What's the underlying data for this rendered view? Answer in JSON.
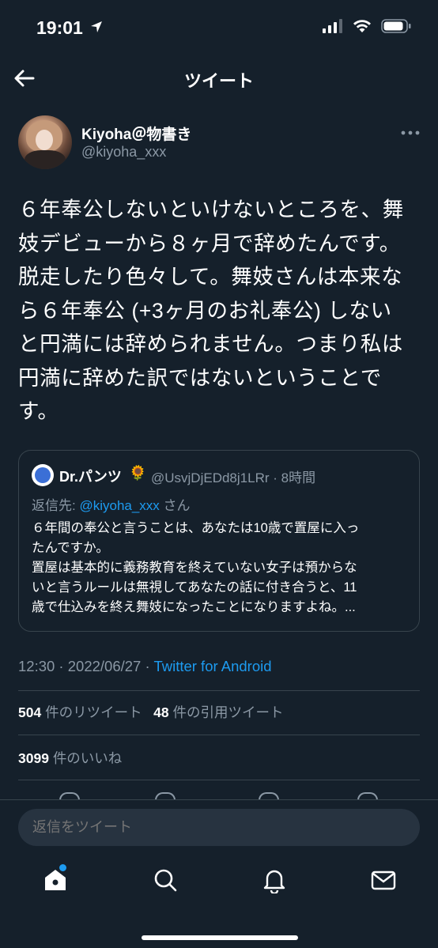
{
  "status_bar": {
    "time": "19:01"
  },
  "nav": {
    "title": "ツイート"
  },
  "author": {
    "name": "Kiyoha＠物書き",
    "handle": "@kiyoha_xxx"
  },
  "tweet": {
    "lines": [
      "６年奉公しないといけないところを、舞",
      "妓デビューから８ヶ月で辞めたんです。",
      "脱走したり色々して。舞妓さんは本来な",
      "ら６年奉公 (+3ヶ月のお礼奉公) しない",
      "と円満には辞められません。つまり私は",
      "円満に辞めた訳ではないということで",
      "す。"
    ]
  },
  "quoted_tweet": {
    "name": "Dr.パンツ",
    "emoji": "🌻",
    "handle_time": "@UsvjDjEDd8j1LRr · 8時間",
    "reply_prefix": "返信先: ",
    "reply_mention": "@kiyoha_xxx",
    "reply_suffix": " さん",
    "lines": [
      "６年間の奉公と言うことは、あなたは10歳で置屋に入っ",
      "たんですか。",
      "置屋は基本的に義務教育を終えていない女子は預からな",
      "いと言うルールは無視してあなたの話に付き合うと、11",
      "歳で仕込みを終え舞妓になったことになりますよね。..."
    ]
  },
  "meta": {
    "time_date": "12:30 · 2022/06/27 · ",
    "source": "Twitter for Android"
  },
  "stats": {
    "retweets_count": "504",
    "retweets_label": "件のリツイート",
    "quotes_count": "48",
    "quotes_label": "件の引用ツイート",
    "likes_count": "3099",
    "likes_label": "件のいいね"
  },
  "reply_box": {
    "placeholder": "返信をツイート"
  },
  "colors": {
    "background": "#15202b",
    "accent": "#1d9bf0",
    "muted": "#8b98a5",
    "border": "#38444d"
  }
}
